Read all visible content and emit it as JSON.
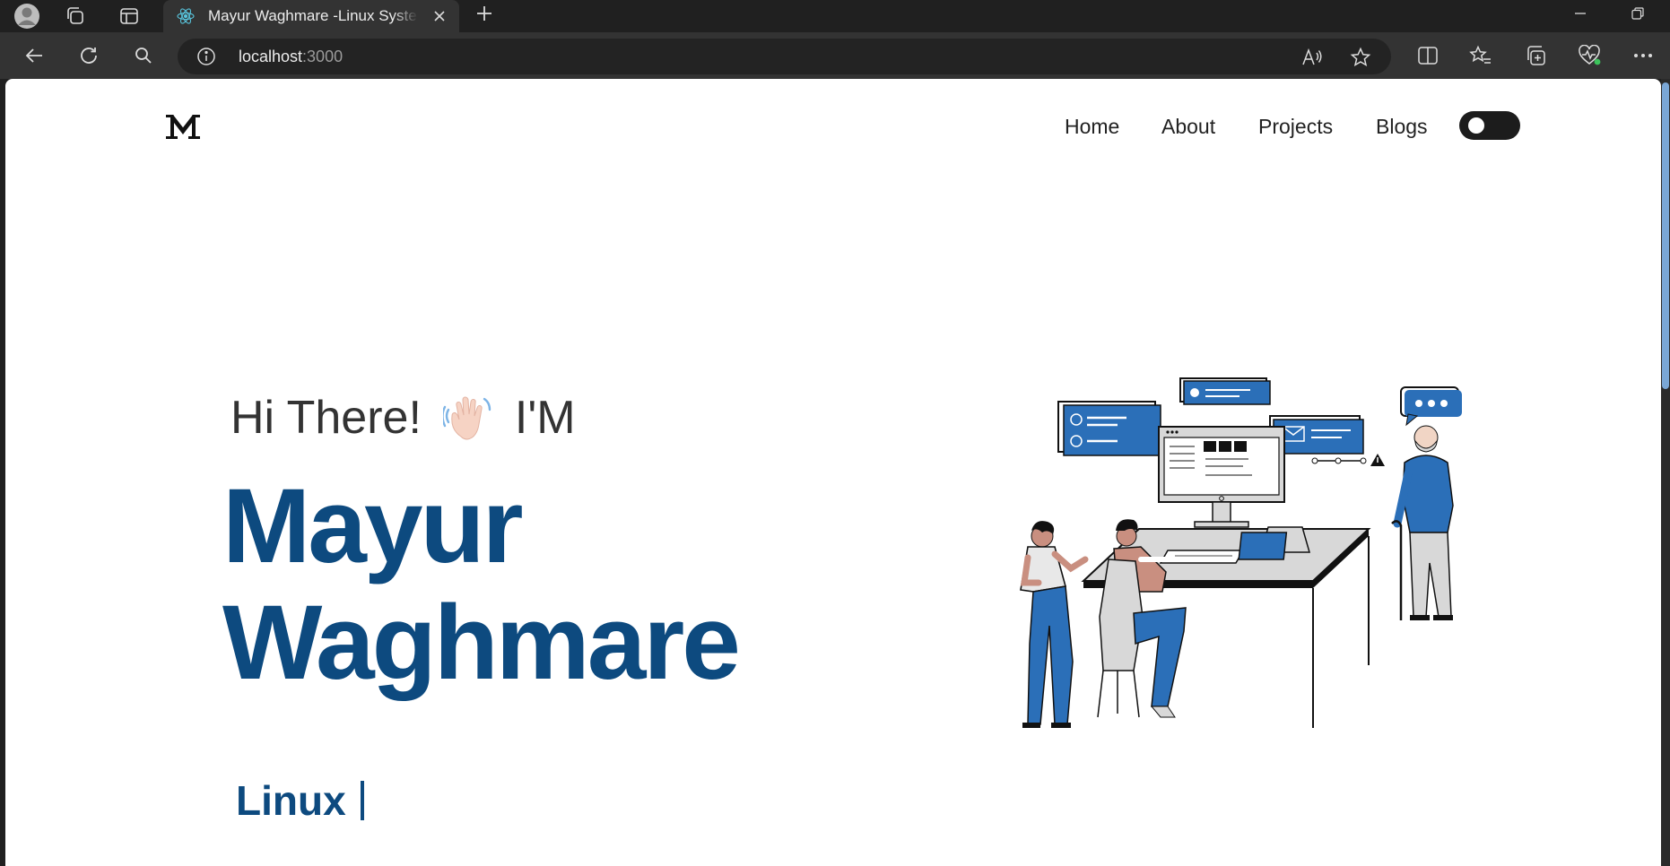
{
  "browser": {
    "tab": {
      "title": "Mayur Waghmare -Linux System Administrator",
      "favicon": "react-icon"
    },
    "address_bar": {
      "host": "localhost",
      "port": ":3000"
    }
  },
  "site": {
    "nav": {
      "items": [
        {
          "label": "Home"
        },
        {
          "label": "About"
        },
        {
          "label": "Projects"
        },
        {
          "label": "Blogs"
        }
      ]
    },
    "hero": {
      "greeting_prefix": "Hi There!",
      "greeting_suffix": "I'M",
      "name_first": "Mayur",
      "name_last": "Waghmare",
      "typed_role": "Linux"
    }
  },
  "colors": {
    "accent": "#0d4a7f",
    "illustration_blue": "#2b6fb8",
    "chrome_dark": "#202020"
  }
}
